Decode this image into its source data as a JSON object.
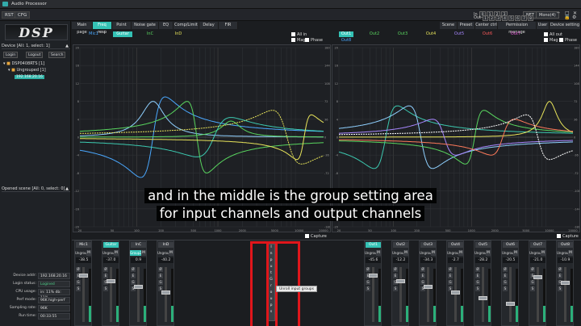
{
  "app": {
    "title": "Audio Processor",
    "menu": [
      "RST",
      "CFG"
    ]
  },
  "topbar": {
    "in_label": "In",
    "in_channels": [
      "0",
      "1",
      "2",
      "3"
    ],
    "out_label": "Out",
    "out_channels": [
      "1",
      "2",
      "3",
      "4",
      "5",
      "6",
      "7",
      "8"
    ],
    "buttons": [
      "NET",
      "Mono(4)"
    ]
  },
  "left": {
    "logo": "DSP",
    "device_header": "Device [All: 1, select: 1]",
    "device_buttons": [
      "Login",
      "Logout",
      "Search"
    ],
    "tree_root": "DSP0408RTS [1]",
    "tree_group": "Ungrouped [1]",
    "tree_ip": "192.168.20.16",
    "scene_header": "Opened scene [All: 0, select: 0]",
    "info": [
      {
        "label": "Device addr:",
        "value": "192.168.20.16"
      },
      {
        "label": "Login status:",
        "value": "Logined"
      },
      {
        "label": "CPU usage:",
        "value": "in: 11% db: 11%"
      },
      {
        "label": "Perf mode:",
        "value": "96K high-perf"
      },
      {
        "label": "Sampling rate:",
        "value": "96K"
      },
      {
        "label": "Run time:",
        "value": "00:33:55"
      }
    ]
  },
  "tabs": [
    "Main page",
    "Freq resp",
    "Point",
    "Noise gate",
    "EQ",
    "Comp/Limit",
    "Delay",
    "FIR"
  ],
  "tab_active": "Freq resp",
  "right_tabs": [
    "Scene",
    "Preset",
    "Center ctrl",
    "Permission manage",
    "User",
    "Device setting"
  ],
  "input_graph": {
    "chips": [
      "Mic1",
      "Guitar",
      "InC",
      "InD"
    ],
    "chips_on": [
      false,
      true,
      false,
      false
    ],
    "checks": {
      "all": "All in",
      "mag": "Mag",
      "phase": "Phase"
    },
    "capture": "Capture"
  },
  "output_graph": {
    "chips_row1": [
      "Out1",
      "Out2",
      "Out3",
      "Out4",
      "Out5",
      "Out6",
      "Out7"
    ],
    "chips_row2": [
      "Out8"
    ],
    "chips_on": [
      true,
      false,
      false,
      false,
      false,
      false,
      false
    ],
    "checks": {
      "all": "All out",
      "mag": "Mag",
      "phase": "Phase"
    },
    "capture": "Capture"
  },
  "graph_ticks": {
    "y_right": [
      "180",
      "144",
      "108",
      "72",
      "36",
      "0",
      "-36",
      "-72",
      "-108",
      "-144",
      "-180"
    ],
    "y_left": [
      "20",
      "16",
      "12",
      "8",
      "4",
      "0",
      "-4",
      "-8",
      "-12",
      "-16",
      "-20"
    ],
    "x": [
      "20",
      "50",
      "100",
      "200",
      "500",
      "1000",
      "2000",
      "5000",
      "10000",
      "20000"
    ]
  },
  "subtitle": [
    "and in the middle is the group setting area",
    "for input channels and output channels"
  ],
  "input_strips": [
    {
      "name": "Mic1",
      "on": false,
      "group": "Ungroup",
      "group_on": false,
      "value": "-38.5"
    },
    {
      "name": "Guitar",
      "on": true,
      "group": "Ungroup",
      "group_on": false,
      "value": "-37.0"
    },
    {
      "name": "InC",
      "on": false,
      "group": "Group2",
      "group_on": true,
      "value": "0.9"
    },
    {
      "name": "InD",
      "on": false,
      "group": "Ungroup",
      "group_on": false,
      "value": "-40.2"
    }
  ],
  "output_strips": [
    {
      "name": "Out1",
      "on": true,
      "group": "Ungroup",
      "group_on": false,
      "value": "-45.6"
    },
    {
      "name": "Out2",
      "on": false,
      "group": "Ungroup",
      "group_on": false,
      "value": "-12.2"
    },
    {
      "name": "Out3",
      "on": false,
      "group": "Ungroup",
      "group_on": false,
      "value": "-34.3"
    },
    {
      "name": "Out4",
      "on": false,
      "group": "Ungroup",
      "group_on": false,
      "value": "-2.7"
    },
    {
      "name": "Out5",
      "on": false,
      "group": "Ungroup",
      "group_on": false,
      "value": "-28.2"
    },
    {
      "name": "Out6",
      "on": false,
      "group": "Ungroup",
      "group_on": false,
      "value": "-20.5"
    },
    {
      "name": "Out7",
      "on": false,
      "group": "Ungroup",
      "group_on": false,
      "value": "-21.0"
    },
    {
      "name": "Out8",
      "on": false,
      "group": "Ungroup",
      "group_on": false,
      "value": "-10.9"
    }
  ],
  "group_column": [
    "I",
    "n",
    "p",
    "u",
    "t",
    "",
    "G",
    "r",
    "o",
    "u",
    "p",
    "s"
  ],
  "tooltip": "Unroll input groups",
  "colors": {
    "accent": "#34c2b5",
    "highlight": "#e0161b"
  }
}
